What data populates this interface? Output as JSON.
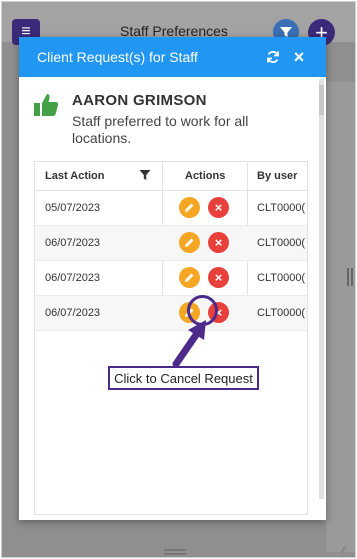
{
  "background": {
    "title": "Staff Preferences",
    "add_label": "+"
  },
  "modal": {
    "title": "Client Request(s) for Staff",
    "close_label": "×"
  },
  "staff": {
    "name": "AARON GRIMSON",
    "description": "Staff preferred to work for all locations."
  },
  "grid": {
    "columns": [
      "Last Action",
      "Actions",
      "By user"
    ],
    "rows": [
      {
        "last_action": "05/07/2023",
        "by_user": "CLT0000("
      },
      {
        "last_action": "06/07/2023",
        "by_user": "CLT0000("
      },
      {
        "last_action": "06/07/2023",
        "by_user": "CLT0000("
      },
      {
        "last_action": "06/07/2023",
        "by_user": "CLT0000("
      }
    ]
  },
  "callout": {
    "text": "Click to Cancel Request"
  },
  "colors": {
    "header_blue": "#2196f3",
    "accent_purple": "#4b2a8a",
    "edit_orange": "#f5a623",
    "cancel_red": "#e8403a",
    "thumb_green": "#43a047"
  }
}
